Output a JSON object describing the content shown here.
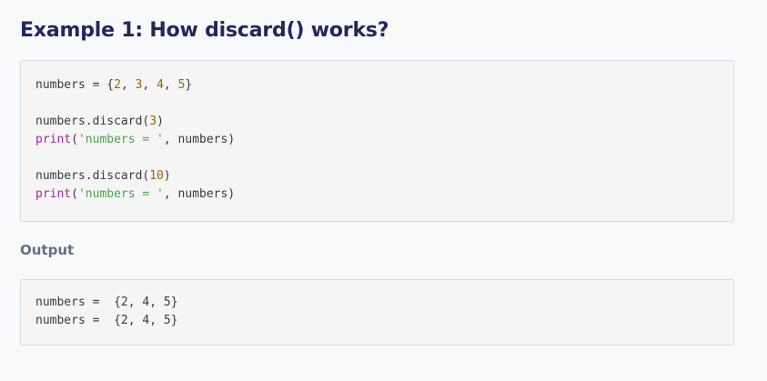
{
  "header": {
    "title": "Example 1: How discard() works?"
  },
  "source_code": {
    "line1": {
      "ident": "numbers",
      "op": " = {",
      "n1": "2",
      "sep1": ", ",
      "n2": "3",
      "sep2": ", ",
      "n3": "4",
      "sep3": ", ",
      "n4": "5",
      "close": "}"
    },
    "line3": {
      "call": "numbers.discard(",
      "arg": "3",
      "close": ")"
    },
    "line4": {
      "builtin": "print",
      "open": "(",
      "str": "'numbers = '",
      "rest": ", numbers)"
    },
    "line6": {
      "call": "numbers.discard(",
      "arg": "10",
      "close": ")"
    },
    "line7": {
      "builtin": "print",
      "open": "(",
      "str": "'numbers = '",
      "rest": ", numbers)"
    }
  },
  "output_section": {
    "heading": "Output",
    "lines": [
      "numbers =  {2, 4, 5}",
      "numbers =  {2, 4, 5}"
    ]
  },
  "colors": {
    "title": "#25265e",
    "subheading": "#656d85",
    "code_text": "#383a42",
    "code_number": "#986801",
    "code_builtin": "#a626a4",
    "code_string": "#50a14f",
    "code_background": "#f5f5f5",
    "code_border": "#d3dce6",
    "page_background": "#f8f9fb"
  }
}
